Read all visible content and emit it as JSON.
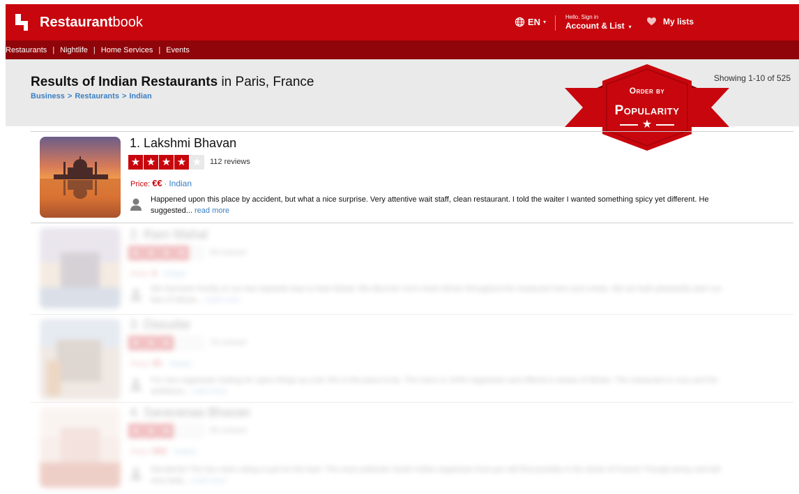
{
  "header": {
    "logo_bold": "Restaurant",
    "logo_light": "book",
    "language": "EN",
    "account_greeting": "Hello. Sign in",
    "account_label": "Account & List",
    "my_lists": "My lists"
  },
  "subnav": {
    "items": [
      "Restaurants",
      "Nightlife",
      "Home Services",
      "Events"
    ]
  },
  "results": {
    "title_bold": "Results of Indian Restaurants",
    "title_rest": " in Paris, France",
    "breadcrumb": [
      "Business",
      "Restaurants",
      "Indian"
    ],
    "showing": "Showing 1-10 of 525"
  },
  "sort_badge": {
    "top": "Order by",
    "main": "Popularity"
  },
  "colors": {
    "brand_red": "#c8060d",
    "subnav_red": "#8f0509",
    "link_blue": "#3a7fc4"
  },
  "restaurants": [
    {
      "name": "1. Lakshmi Bhavan",
      "rating": 4,
      "reviews": "112 reviews",
      "price_label": "Price:",
      "price": "€€",
      "cuisine": "Indian",
      "snippet": "Happened upon this place by accident, but what a nice surprise. Very attentive wait staff, clean restaurant. I told the waiter I wanted something spicy yet different. He suggested...",
      "read_more": "read more"
    },
    {
      "name": "2. Ram Mahal",
      "rating": 4,
      "reviews": "96 reviews",
      "price_label": "Price:",
      "price": "€",
      "cuisine": "Indian",
      "snippet": "We had been fondly on our last separate trips to New Mahal. We discover one's fresh dinner throughout the restaurant here and create. We are both pleasantly seen our fare of dishes...",
      "read_more": "read more"
    },
    {
      "name": "3. Dasudar",
      "rating": 3,
      "reviews": "78 reviews",
      "price_label": "Price:",
      "price": "€€",
      "cuisine": "Indian",
      "snippet": "For new vegetarian looking for spice things up a bit, this is the place to be. The menu is 100% vegetarian and offered a variety of dishes. The restaurant is cozy and the ambiance...",
      "read_more": "read more"
    },
    {
      "name": "4. Saravanaa Bhavan",
      "rating": 3,
      "reviews": "66 reviews",
      "price_label": "Price:",
      "price": "€€€",
      "cuisine": "Indian",
      "snippet": "Wonderful! The four stars rating is just for the food. The most authentic South Indian vegetarian food you will find possibly in the whole of France! Though pricey and still very tasty...",
      "read_more": "read more"
    }
  ]
}
